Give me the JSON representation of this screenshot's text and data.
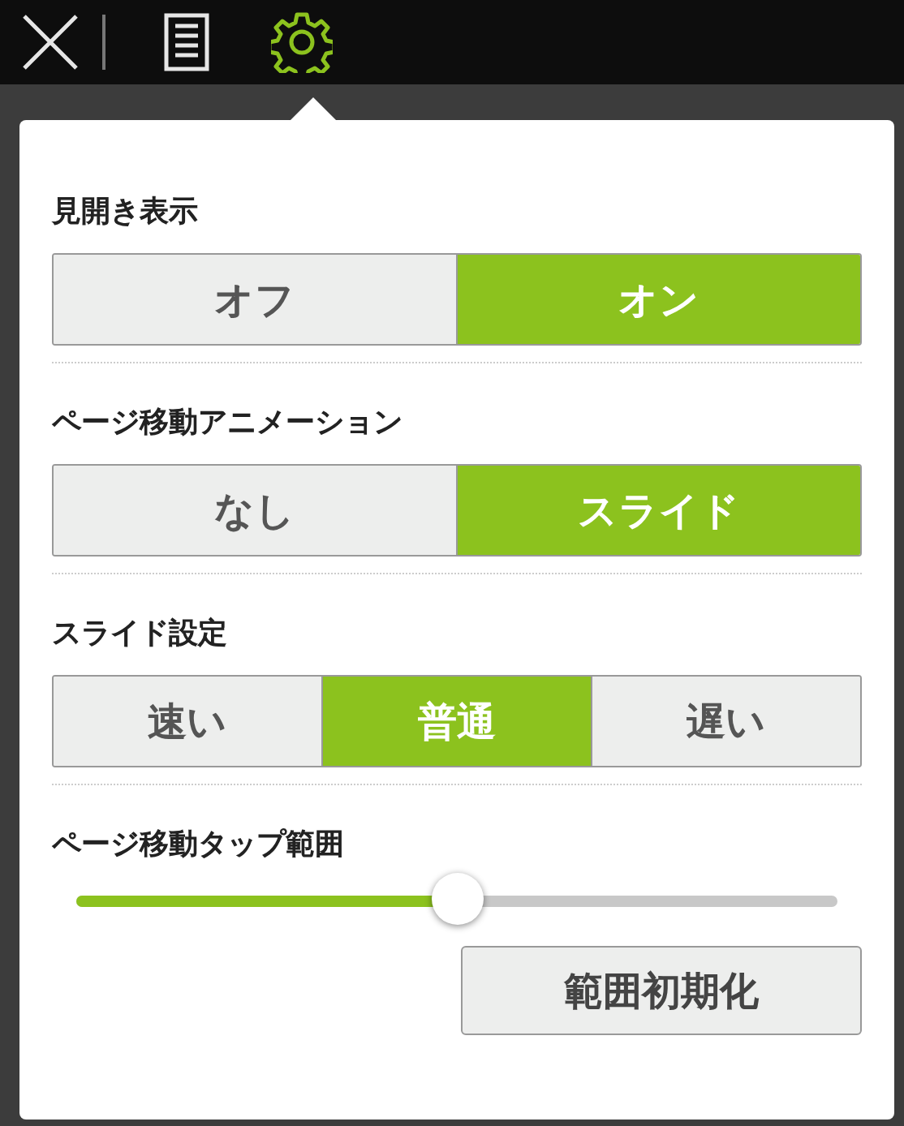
{
  "toolbar": [
    {
      "kind": "close",
      "selected": false
    },
    {
      "kind": "document",
      "selected": false
    },
    {
      "kind": "settings",
      "selected": true
    }
  ],
  "sections": [
    {
      "kind": "segmented",
      "title": "見開き表示",
      "options": [
        {
          "label": "オフ",
          "selected": false
        },
        {
          "label": "オン",
          "selected": true
        }
      ]
    },
    {
      "kind": "segmented",
      "title": "ページ移動アニメーション",
      "options": [
        {
          "label": "なし",
          "selected": false
        },
        {
          "label": "スライド",
          "selected": true
        }
      ]
    },
    {
      "kind": "segmented",
      "title": "スライド設定",
      "options": [
        {
          "label": "速い",
          "selected": false
        },
        {
          "label": "普通",
          "selected": true
        },
        {
          "label": "遅い",
          "selected": false
        }
      ]
    },
    {
      "kind": "slider",
      "title": "ページ移動タップ範囲",
      "level": 0.5,
      "button": "範囲初期化"
    }
  ]
}
